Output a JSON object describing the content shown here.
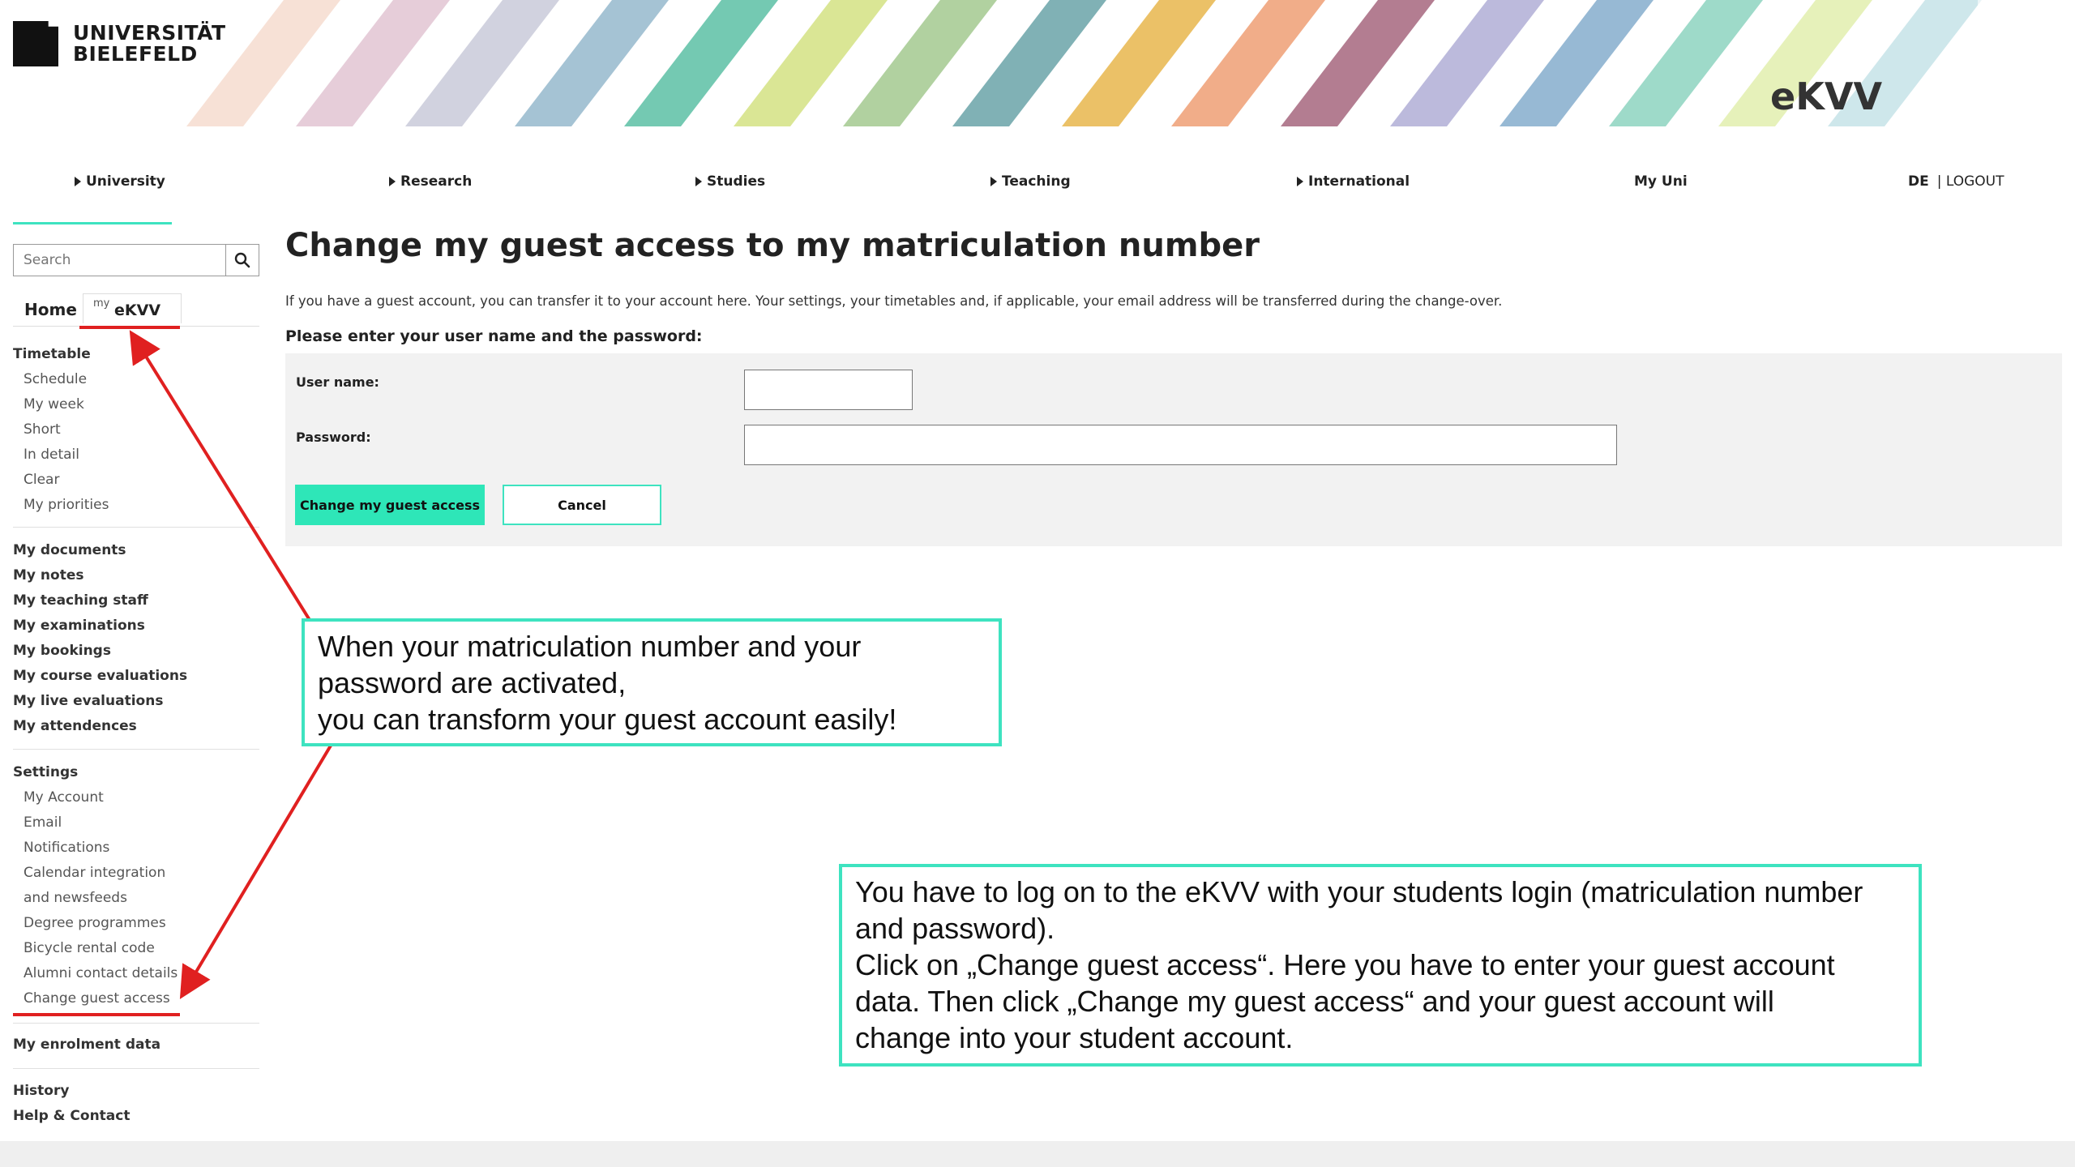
{
  "brand": {
    "logo_line1": "UNIVERSITÄT",
    "logo_line2": "BIELEFELD",
    "app_title": "eKVV",
    "stripe_colors": [
      "#f6dccf",
      "#e2c4d2",
      "#c9cad9",
      "#95b9cc",
      "#5cbfa4",
      "#d3e283",
      "#a3c98f",
      "#6aa3a8",
      "#e8b64c",
      "#ef9f74",
      "#a6667e",
      "#b0aed6",
      "#85adcc",
      "#8dd4bf",
      "#e2eeae",
      "#c6e3e7"
    ]
  },
  "topnav": {
    "items": [
      "University",
      "Research",
      "Studies",
      "Teaching",
      "International"
    ],
    "my_uni": "My Uni",
    "lang": "DE",
    "logout": "| LOGOUT"
  },
  "sidebar": {
    "search_placeholder": "Search",
    "tab_home": "Home",
    "tab_my": "my",
    "tab_ekvv": "eKVV",
    "timetable": {
      "heading": "Timetable",
      "items": [
        "Schedule",
        "My week",
        "Short",
        "In detail",
        "Clear",
        "My priorities"
      ]
    },
    "personal": [
      "My documents",
      "My notes",
      "My teaching staff",
      "My examinations",
      "My bookings",
      "My course evaluations",
      "My live evaluations",
      "My attendences"
    ],
    "settings": {
      "heading": "Settings",
      "items": [
        "My Account",
        "Email",
        "Notifications",
        "Calendar integration",
        "and newsfeeds",
        "Degree programmes",
        "Bicycle rental code",
        "Alumni contact details",
        "Change guest access"
      ]
    },
    "enrolment": "My enrolment data",
    "history": "History",
    "help": "Help & Contact"
  },
  "main": {
    "title": "Change my guest access to my matriculation number",
    "intro": "If you have a guest account, you can transfer it to your account here. Your settings, your timetables and, if applicable, your email address will be transferred during the change-over.",
    "enter_prompt": "Please enter your user name and the password:",
    "username_label": "User name:",
    "password_label": "Password:",
    "username_value": "",
    "password_value": "",
    "submit_label": "Change my guest access",
    "cancel_label": "Cancel"
  },
  "annotations": {
    "callout1": [
      "When your matriculation number and your",
      "password are activated,",
      "you can transform your guest account easily!"
    ],
    "callout2": [
      "You have to log on to the eKVV with your students login (matriculation number",
      "and password).",
      "Click on „Change guest access“. Here you have to enter your guest account",
      "data. Then click „Change my guest access“ and your guest account will",
      "change into your student account."
    ],
    "accent_color": "#3ee3c0",
    "arrow_color": "#e02020"
  }
}
